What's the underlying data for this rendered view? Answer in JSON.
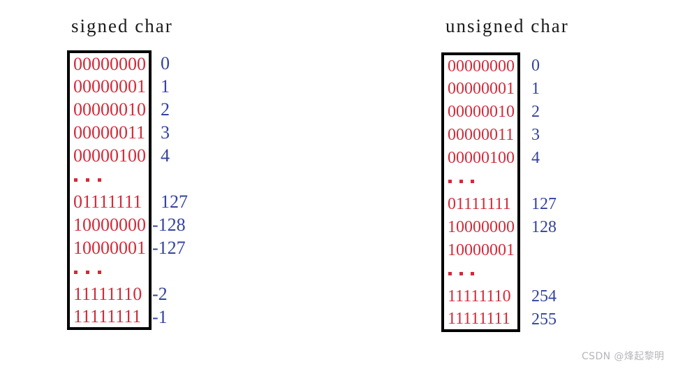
{
  "figure": {
    "background_color": "#ffffff",
    "bits_color": "#d22b39",
    "value_color": "#33429c",
    "border_color": "#000000",
    "title_color": "#1a1a1a",
    "ellipsis_glyph": "..."
  },
  "columns": [
    {
      "id": "signed",
      "title": "signed char",
      "rows": [
        {
          "bits": "00000000",
          "value": "0",
          "kind": "data"
        },
        {
          "bits": "00000001",
          "value": "1",
          "kind": "data"
        },
        {
          "bits": "00000010",
          "value": "2",
          "kind": "data"
        },
        {
          "bits": "00000011",
          "value": "3",
          "kind": "data"
        },
        {
          "bits": "00000100",
          "value": "4",
          "kind": "data"
        },
        {
          "bits": "...",
          "value": "",
          "kind": "ellipsis"
        },
        {
          "bits": "01111111",
          "value": "127",
          "kind": "data"
        },
        {
          "bits": "10000000",
          "value": "-128",
          "kind": "data"
        },
        {
          "bits": "10000001",
          "value": "-127",
          "kind": "data"
        },
        {
          "bits": "...",
          "value": "",
          "kind": "ellipsis"
        },
        {
          "bits": "11111110",
          "value": "-2",
          "kind": "data"
        },
        {
          "bits": "11111111",
          "value": "-1",
          "kind": "data"
        }
      ]
    },
    {
      "id": "unsigned",
      "title": "unsigned char",
      "rows": [
        {
          "bits": "00000000",
          "value": "0",
          "kind": "data"
        },
        {
          "bits": "00000001",
          "value": "1",
          "kind": "data"
        },
        {
          "bits": "00000010",
          "value": "2",
          "kind": "data"
        },
        {
          "bits": "00000011",
          "value": "3",
          "kind": "data"
        },
        {
          "bits": "00000100",
          "value": "4",
          "kind": "data"
        },
        {
          "bits": "...",
          "value": "",
          "kind": "ellipsis"
        },
        {
          "bits": "01111111",
          "value": "127",
          "kind": "data"
        },
        {
          "bits": "10000000",
          "value": "128",
          "kind": "data"
        },
        {
          "bits": "10000001",
          "value": "",
          "kind": "data"
        },
        {
          "bits": "...",
          "value": "",
          "kind": "ellipsis"
        },
        {
          "bits": "11111110",
          "value": "254",
          "kind": "data"
        },
        {
          "bits": "11111111",
          "value": "255",
          "kind": "data"
        }
      ]
    }
  ],
  "watermark": {
    "text": "CSDN @烽起黎明"
  }
}
